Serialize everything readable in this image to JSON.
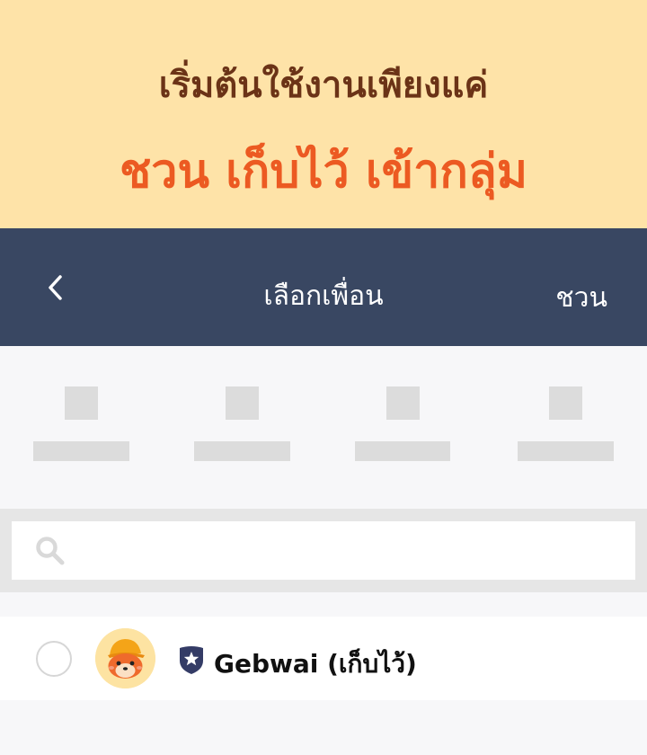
{
  "promo": {
    "line1": "เริ่มต้นใช้งานเพียงแค่",
    "line2": "ชวน เก็บไว้ เข้ากลุ่ม"
  },
  "navbar": {
    "back_icon": "chevron-left-icon",
    "title": "เลือกเพื่อน",
    "invite_label": "ชวน"
  },
  "search": {
    "icon": "search-icon",
    "placeholder": "",
    "value": ""
  },
  "friends": [
    {
      "name": "Gebwai (เก็บไว้)",
      "selected": false,
      "badge_icon": "star-shield-icon",
      "avatar_icon": "gebwai-avatar-icon"
    }
  ],
  "colors": {
    "promo_bg": "#fee3a8",
    "promo_line1": "#6b3317",
    "promo_line2": "#ec5a22",
    "navbar_bg": "#394762",
    "badge": "#343c66"
  }
}
